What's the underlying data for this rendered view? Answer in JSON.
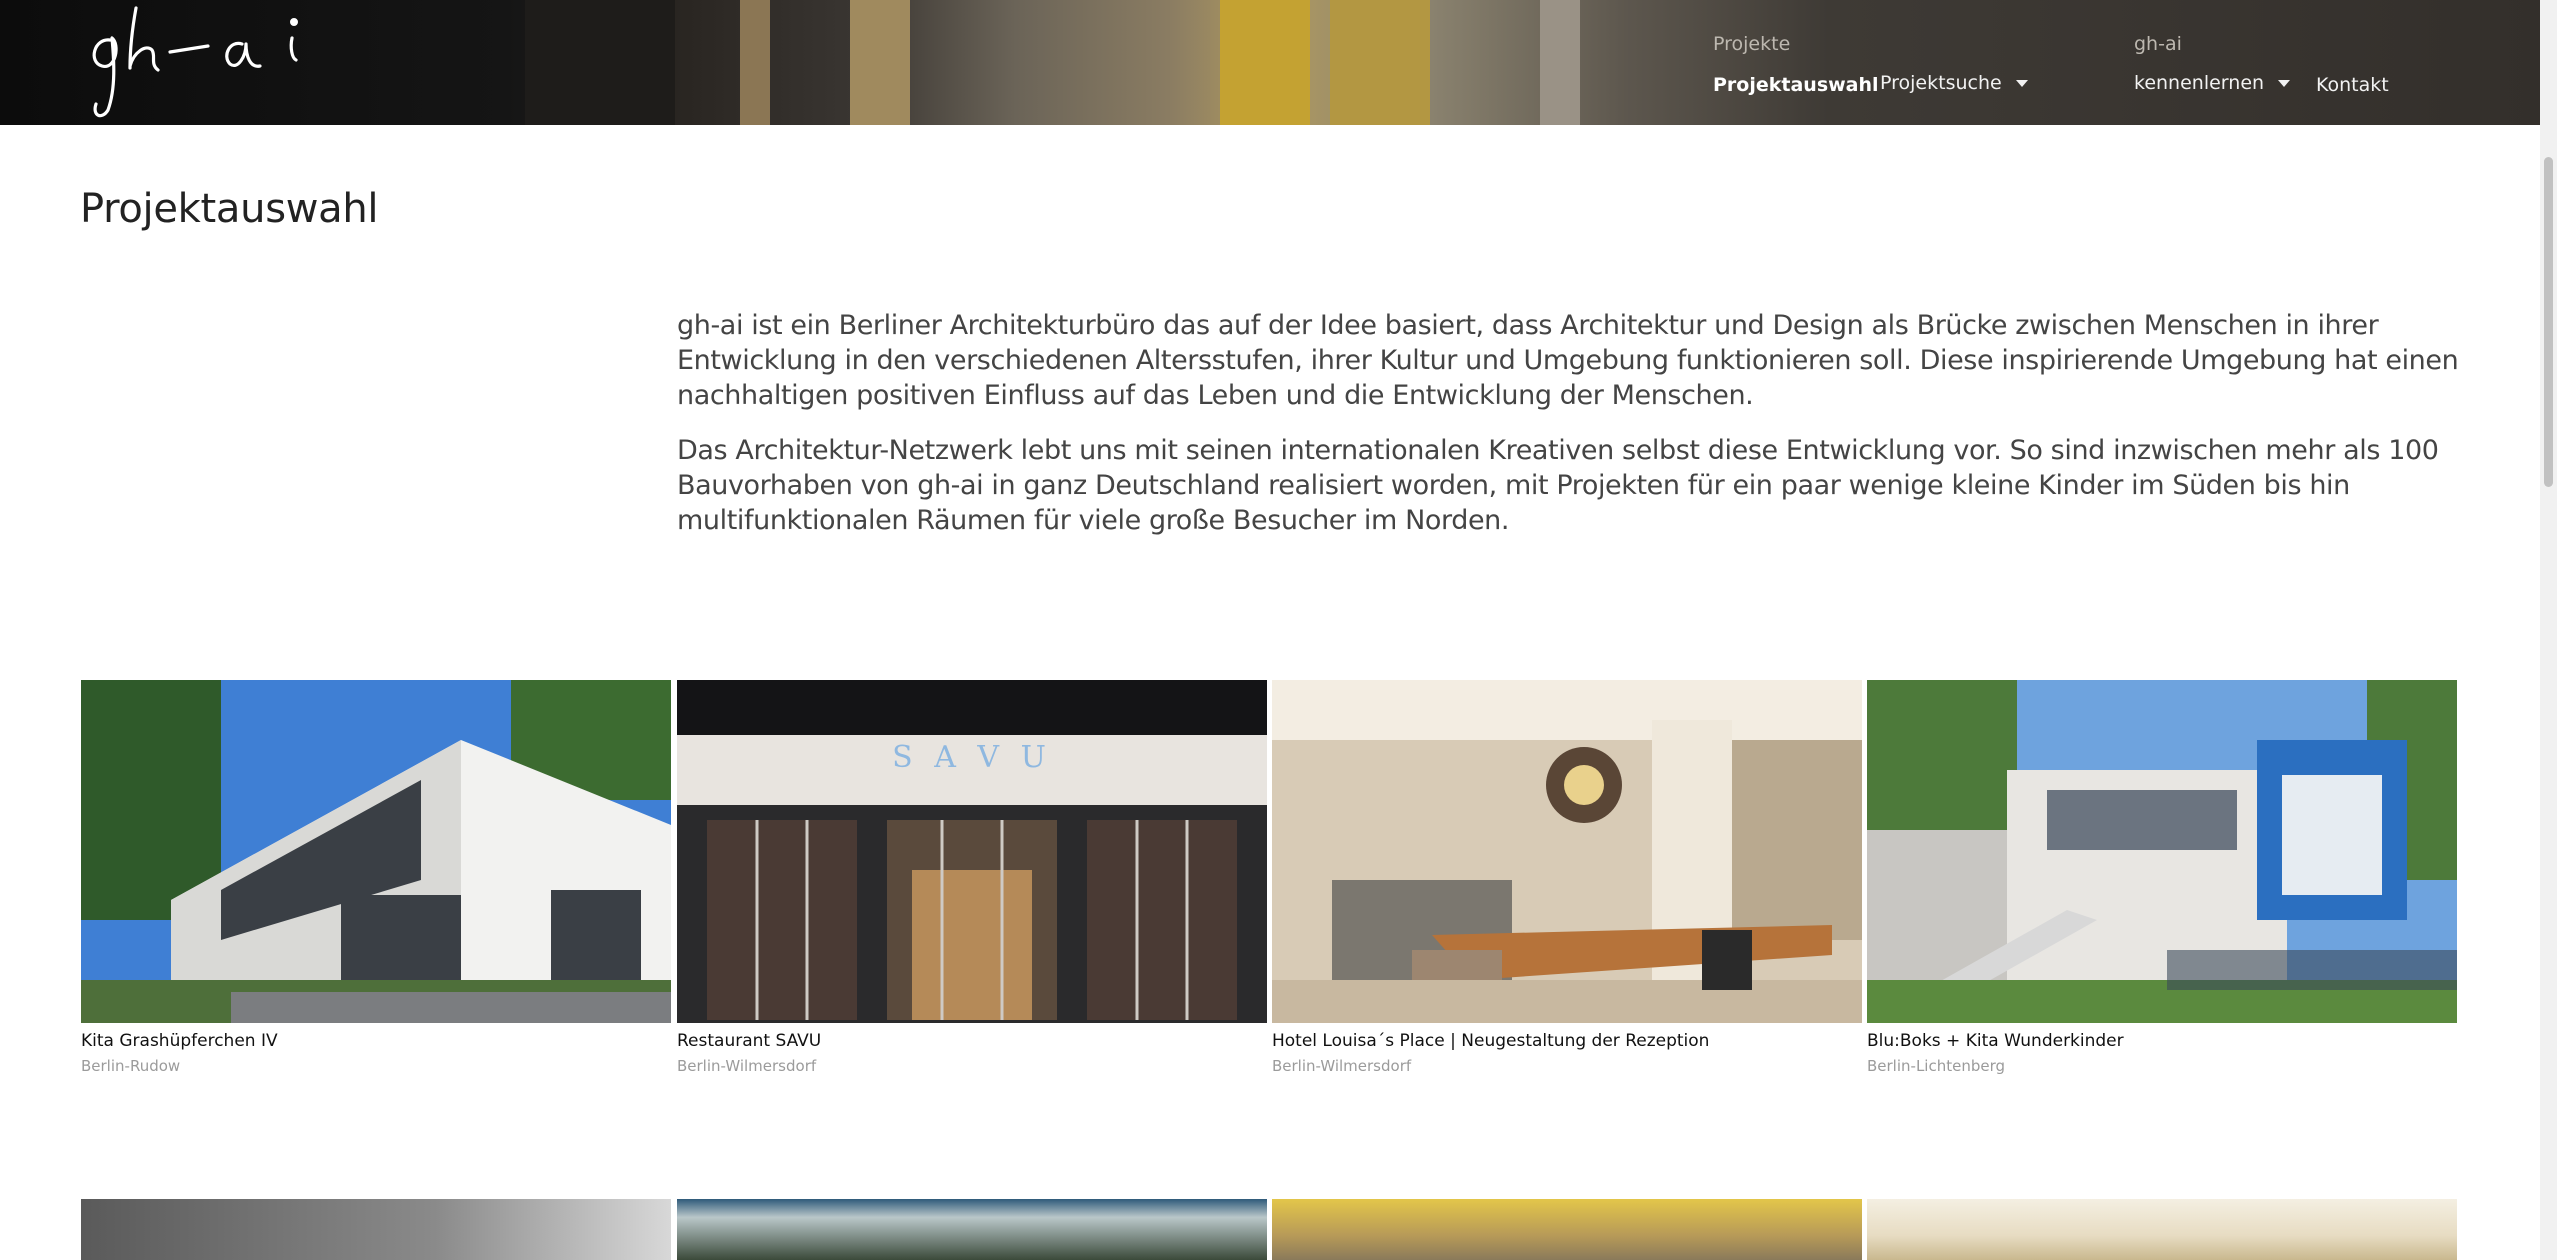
{
  "header": {
    "logo_text": "gh-ai",
    "nav": {
      "projekte_label": "Projekte",
      "projektauswahl_label": "Projektauswahl",
      "projektsuche_label": "Projektsuche",
      "ghai_label": "gh-ai",
      "kennenlernen_label": "kennenlernen",
      "kontakt_label": "Kontakt"
    }
  },
  "main": {
    "title": "Projektauswahl",
    "intro_paragraphs": [
      "gh-ai ist ein Berliner Architekturbüro das auf der Idee basiert, dass Architektur und Design als Brücke zwischen Menschen in ihrer Entwicklung in den verschiedenen Altersstufen, ihrer Kultur und Umgebung funktionieren soll. Diese inspirierende Umgebung hat einen nachhaltigen positiven Einfluss auf das Leben und die Entwicklung der Menschen.",
      "Das Architektur-Netzwerk lebt uns mit seinen internationalen Kreativen selbst diese Entwicklung vor. So sind inzwischen mehr als 100 Bauvorhaben von gh-ai in ganz Deutschland realisiert worden, mit Projekten für ein paar wenige kleine Kinder im Süden bis hin multifunktionalen Räumen für viele große Besucher im Norden."
    ],
    "projects": [
      {
        "title": "Kita Grashüpferchen IV",
        "location": "Berlin-Rudow"
      },
      {
        "title": "Restaurant SAVU",
        "location": "Berlin-Wilmersdorf",
        "sign_text": "S A V U"
      },
      {
        "title": "Hotel Louisa´s Place | Neugestaltung der Rezeption",
        "location": "Berlin-Wilmersdorf"
      },
      {
        "title": "Blu:Boks + Kita Wunderkinder",
        "location": "Berlin-Lichtenberg"
      }
    ]
  },
  "colors": {
    "header_bg": "#332f2b",
    "text_dark": "#222222",
    "text_muted": "#9b9b9b"
  }
}
